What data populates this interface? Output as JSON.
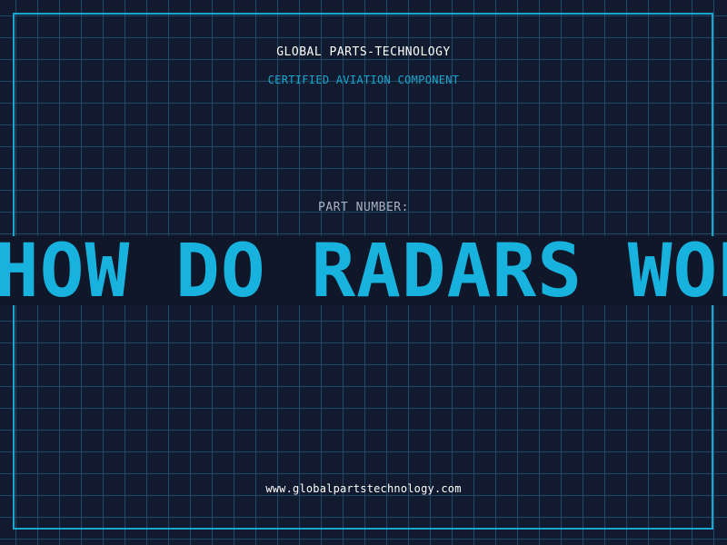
{
  "header": {
    "brand": "GLOBAL PARTS-TECHNOLOGY",
    "tagline": "CERTIFIED AVIATION COMPONENT"
  },
  "part": {
    "label": "PART NUMBER:",
    "value": "HOW DO RADARS WORK"
  },
  "footer": {
    "website": "www.globalpartstechnology.com"
  },
  "colors": {
    "background": "#111a2e",
    "grid": "#1e4a66",
    "accent": "#1aa6cf",
    "banner_text": "#17b3de",
    "banner_bg": "#0f1729"
  }
}
